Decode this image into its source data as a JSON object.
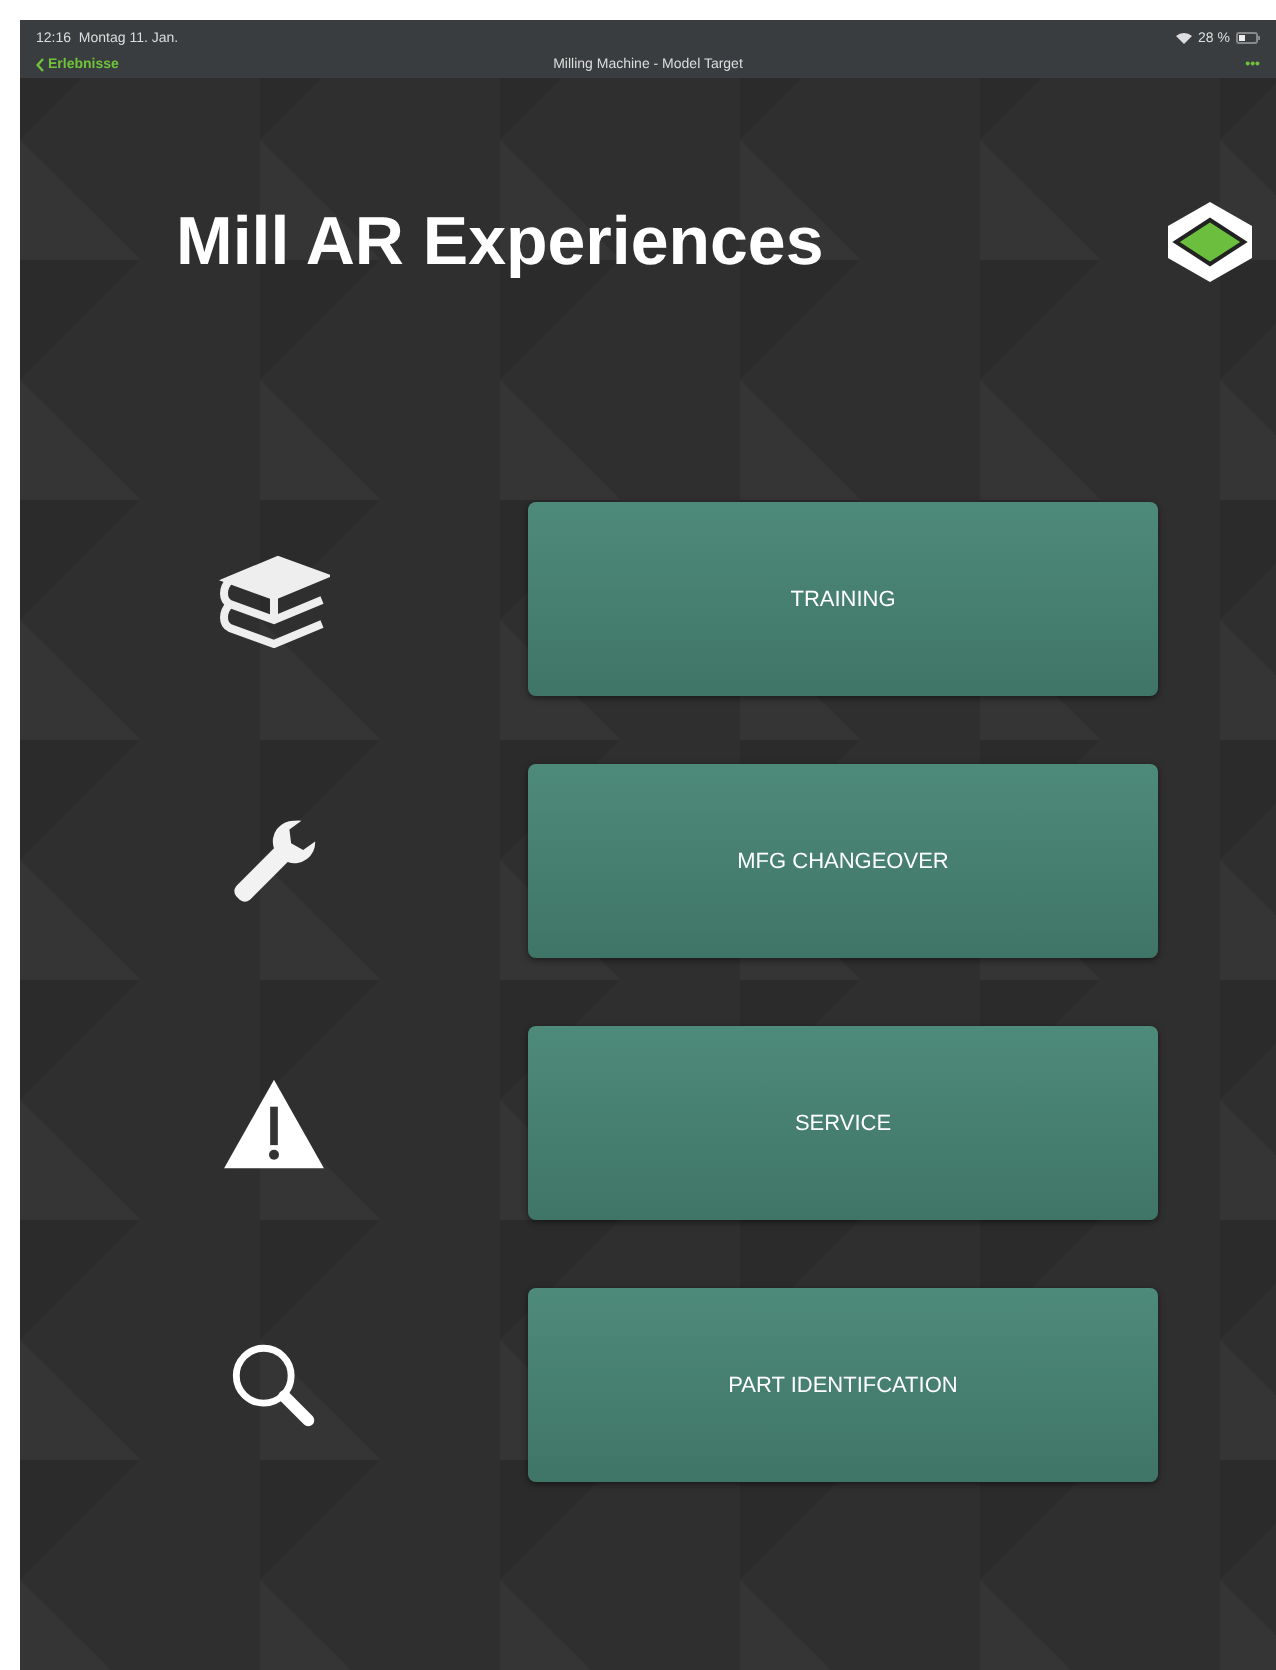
{
  "status_bar": {
    "time": "12:16",
    "date": "Montag 11. Jan.",
    "battery": "28 %"
  },
  "nav_bar": {
    "back": "Erlebnisse",
    "title": "Milling Machine - Model Target",
    "more": "•••"
  },
  "title": "Mill AR Experiences",
  "menu": [
    {
      "label": "TRAINING"
    },
    {
      "label": "MFG CHANGEOVER"
    },
    {
      "label": "SERVICE"
    },
    {
      "label": "PART IDENTIFCATION"
    }
  ]
}
